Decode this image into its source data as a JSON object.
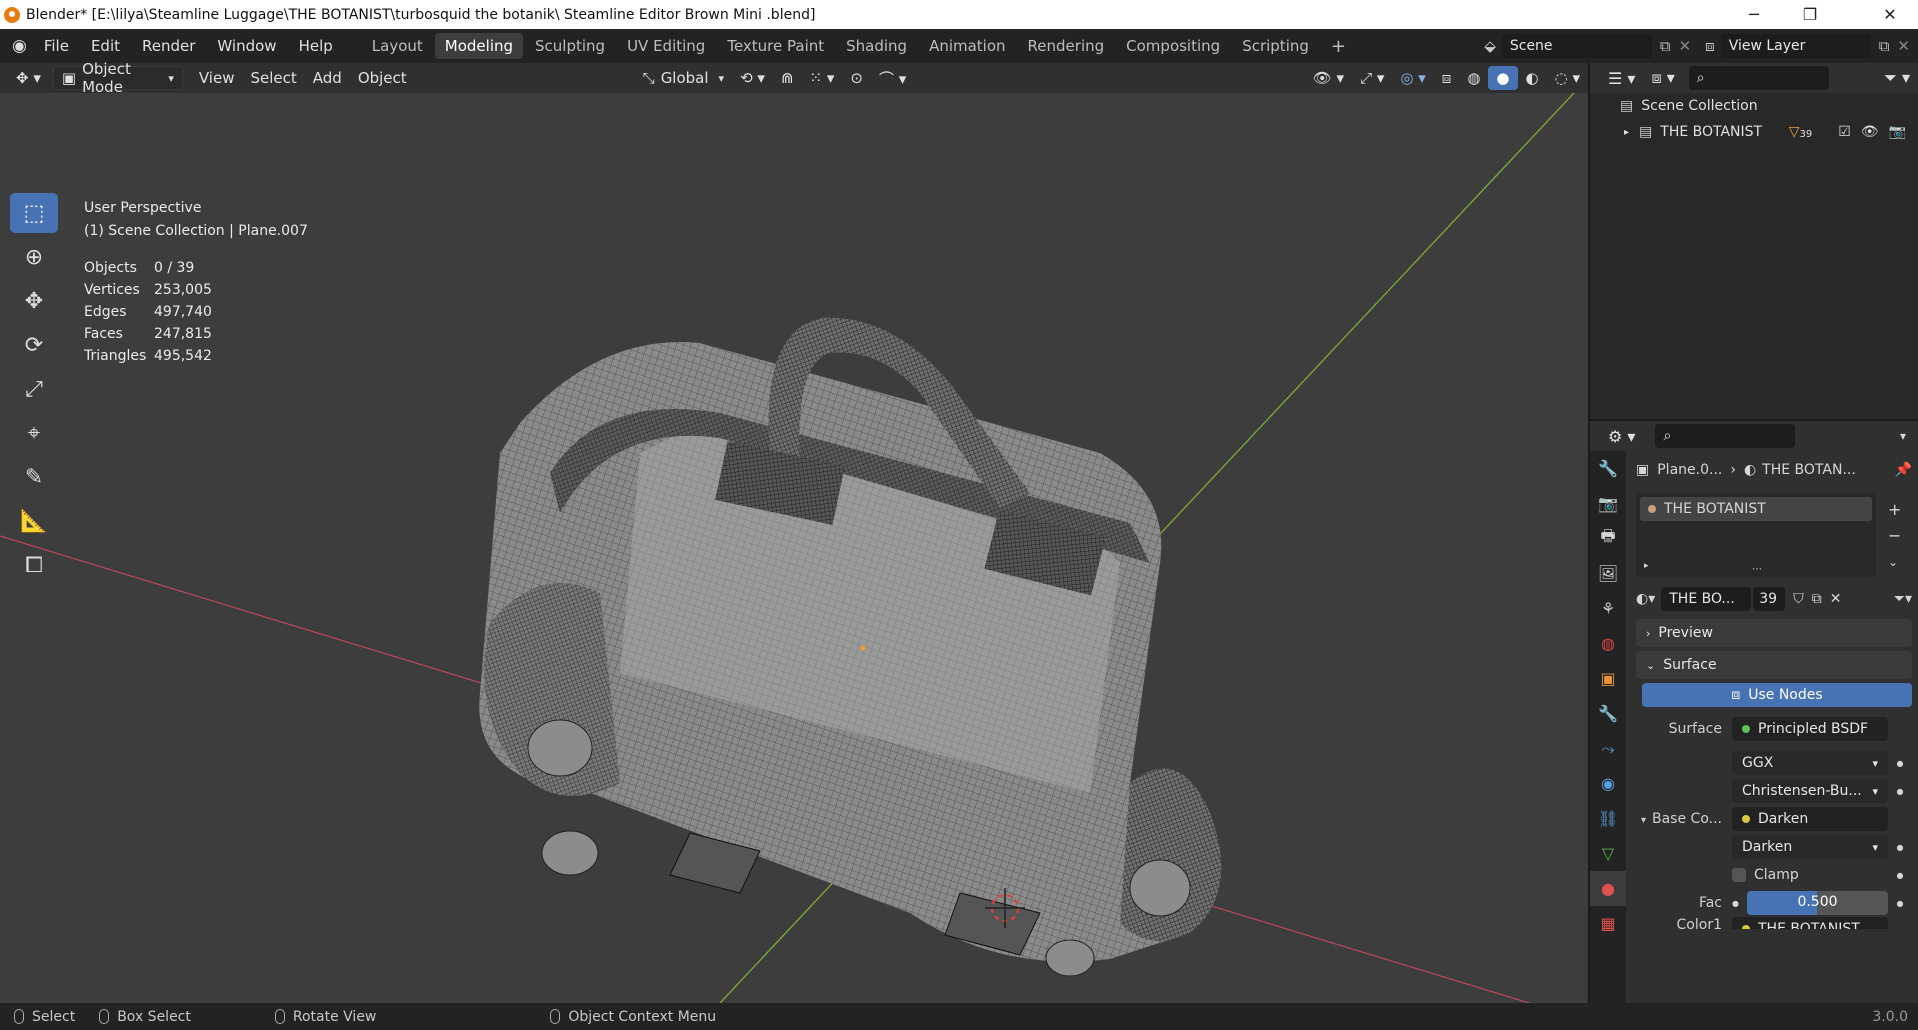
{
  "window": {
    "title": "Blender* [E:\\lilya\\Steamline Luggage\\THE BOTANIST\\turbosquid the botanik\\ Steamline Editor Brown Mini .blend]",
    "min_glyph": "─",
    "max_glyph": "❐",
    "close_glyph": "✕"
  },
  "menubar": {
    "menus": [
      "File",
      "Edit",
      "Render",
      "Window",
      "Help"
    ],
    "workspaces": [
      "Layout",
      "Modeling",
      "Sculpting",
      "UV Editing",
      "Texture Paint",
      "Shading",
      "Animation",
      "Rendering",
      "Compositing",
      "Scripting"
    ],
    "active_workspace": "Modeling",
    "add_tab": "+",
    "scene_label": "Scene",
    "view_layer_label": "View Layer"
  },
  "viewport_header": {
    "mode": "Object Mode",
    "menus": [
      "View",
      "Select",
      "Add",
      "Object"
    ],
    "transform_orientation": "Global"
  },
  "viewport": {
    "perspective": "User Perspective",
    "collection_info": "(1) Scene Collection | Plane.007",
    "stats": [
      {
        "label": "Objects",
        "value": "0 / 39"
      },
      {
        "label": "Vertices",
        "value": "253,005"
      },
      {
        "label": "Edges",
        "value": "497,740"
      },
      {
        "label": "Faces",
        "value": "247,815"
      },
      {
        "label": "Triangles",
        "value": "495,542"
      }
    ]
  },
  "outliner": {
    "scene_collection": "Scene Collection",
    "collection_name": "THE BOTANIST",
    "object_count": "39"
  },
  "properties": {
    "breadcrumb_object": "Plane.0...",
    "breadcrumb_material": "THE BOTAN...",
    "material_slot": "THE BOTANIST",
    "material_name": "THE BO...",
    "user_count": "39",
    "preview_label": "Preview",
    "surface_section": "Surface",
    "use_nodes": "Use Nodes",
    "surface_label": "Surface",
    "surface_value": "Principled BSDF",
    "distribution": "GGX",
    "subsurface_method": "Christensen-Bu...",
    "base_color_label": "Base Co...",
    "base_color_value": "Darken",
    "blend_mode": "Darken",
    "clamp_label": "Clamp",
    "fac_label": "Fac",
    "fac_value": "0.500",
    "fac_fraction": 0.5,
    "color1_label": "Color1",
    "color1_value": "THE BOTANIST"
  },
  "statusbar": {
    "select": "Select",
    "box_select": "Box Select",
    "rotate_view": "Rotate View",
    "context_menu": "Object Context Menu",
    "version": "3.0.0"
  },
  "colors": {
    "accent": "#4772b3",
    "x_axis": "#b8485a",
    "y_axis": "#7fa83b",
    "viewport_bg": "#3d3d3d"
  }
}
